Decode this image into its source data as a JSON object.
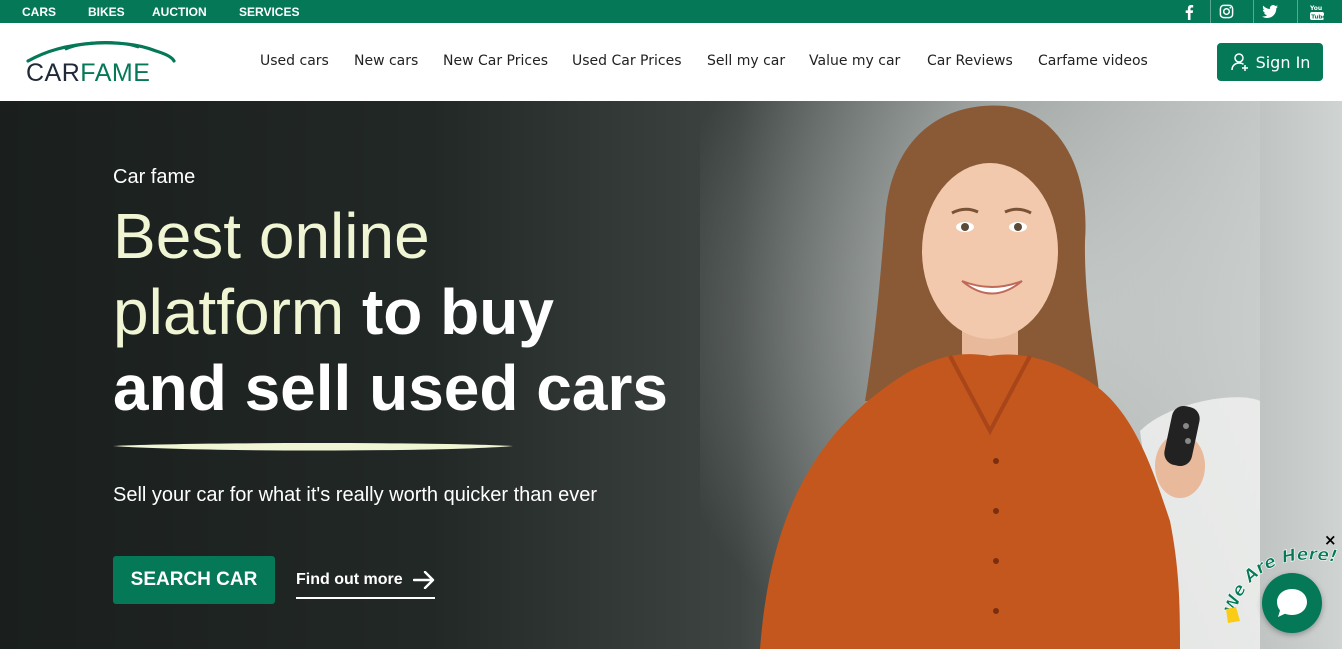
{
  "topbar": {
    "links": [
      "CARS",
      "BIKES",
      "AUCTION",
      "SERVICES"
    ],
    "social": [
      "facebook-icon",
      "instagram-icon",
      "twitter-icon",
      "youtube-icon"
    ]
  },
  "header": {
    "logo_part1": "CAR",
    "logo_part2": "FAME",
    "nav": [
      "Used cars",
      "New cars",
      "New Car Prices",
      "Used Car Prices",
      "Sell my car",
      "Value my car",
      "Car Reviews",
      "Carfame videos"
    ],
    "signin_label": "Sign In"
  },
  "hero": {
    "eyebrow": "Car fame",
    "line1": "Best online",
    "line2_light": "platform",
    "line2_bold": "to buy",
    "line3": "and sell used cars",
    "subtitle": "Sell your car for what it's really worth quicker than ever",
    "search_button": "SEARCH CAR",
    "find_more": "Find out more"
  },
  "chat": {
    "tag_text": "We Are Here!",
    "close": "×"
  },
  "colors": {
    "brand": "#047857",
    "hero_accent": "#f0f5d4"
  }
}
